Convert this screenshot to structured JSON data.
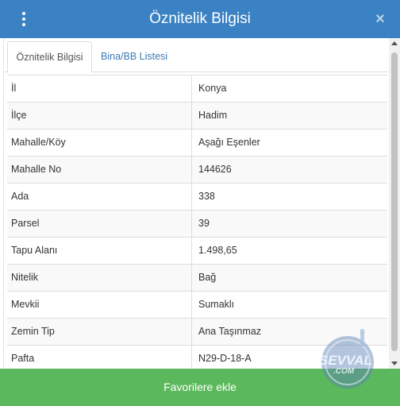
{
  "header": {
    "title": "Öznitelik Bilgisi",
    "menu_icon": "vertical-dots-icon",
    "close_label": "×"
  },
  "tabs": [
    {
      "label": "Öznitelik Bilgisi",
      "active": true
    },
    {
      "label": "Bina/BB Listesi",
      "active": false
    }
  ],
  "attributes": [
    {
      "key": "İl",
      "value": "Konya"
    },
    {
      "key": "İlçe",
      "value": "Hadim"
    },
    {
      "key": "Mahalle/Köy",
      "value": "Aşağı Eşenler"
    },
    {
      "key": "Mahalle No",
      "value": "144626"
    },
    {
      "key": "Ada",
      "value": "338"
    },
    {
      "key": "Parsel",
      "value": "39"
    },
    {
      "key": "Tapu Alanı",
      "value": "1.498,65"
    },
    {
      "key": "Nitelik",
      "value": "Bağ"
    },
    {
      "key": "Mevkii",
      "value": "Sumaklı"
    },
    {
      "key": "Zemin Tip",
      "value": "Ana Taşınmaz"
    },
    {
      "key": "Pafta",
      "value": "N29-D-18-A"
    }
  ],
  "footer": {
    "button_label": "Favorilere ekle"
  },
  "watermark": {
    "line1": "SEVVAL",
    "line2": ".COM"
  },
  "colors": {
    "header": "#3b82c4",
    "button": "#5cb85c",
    "link": "#3b7bb8"
  }
}
